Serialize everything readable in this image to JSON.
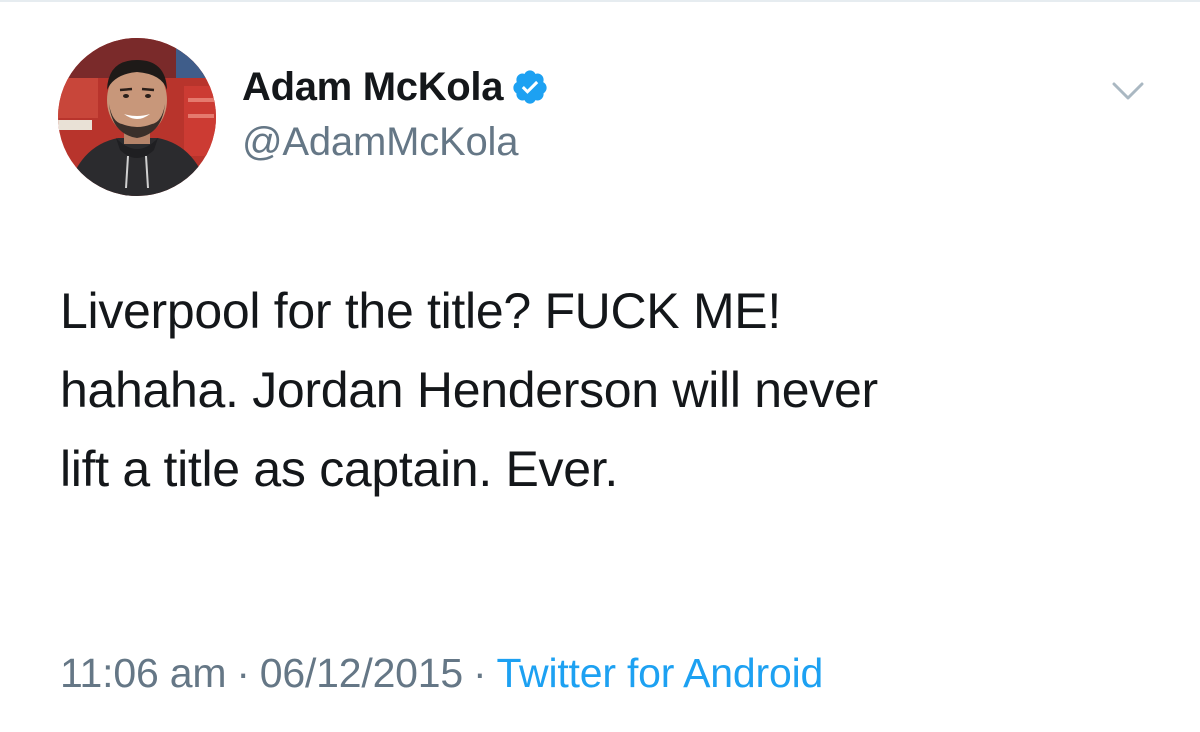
{
  "user": {
    "display_name": "Adam McKola",
    "handle": "@AdamMcKola",
    "verified": true,
    "avatar_icon": "profile-photo"
  },
  "tweet": {
    "lines": [
      "Liverpool for the title? FUCK ME!",
      "hahaha. Jordan Henderson will never",
      "lift a title as captain. Ever."
    ]
  },
  "meta": {
    "time": "11:06 am",
    "separator": "·",
    "date": "06/12/2015",
    "source": "Twitter for Android"
  },
  "icons": {
    "verified": "verified-badge-icon",
    "menu": "chevron-down-icon"
  },
  "colors": {
    "accent": "#1da1f2",
    "secondary_text": "#657786",
    "primary_text": "#14171a"
  }
}
